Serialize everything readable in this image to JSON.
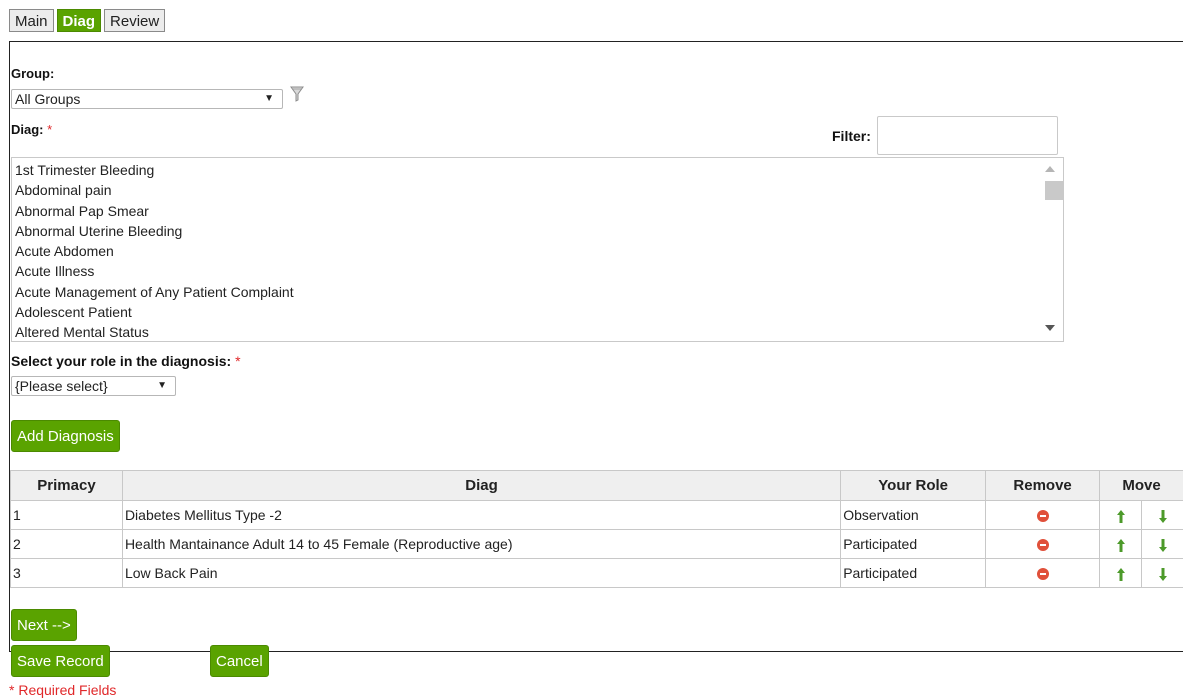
{
  "tabs": [
    {
      "label": "Main",
      "active": false
    },
    {
      "label": "Diag",
      "active": true
    },
    {
      "label": "Review",
      "active": false
    }
  ],
  "group": {
    "label": "Group:",
    "selected": "All Groups",
    "filter_icon": "funnel-icon"
  },
  "diag": {
    "label": "Diag:",
    "required_mark": "*",
    "filter_label": "Filter:",
    "filter_value": "",
    "options": [
      "1st Trimester Bleeding",
      "Abdominal pain",
      "Abnormal Pap Smear",
      "Abnormal Uterine Bleeding",
      "Acute Abdomen",
      "Acute Illness",
      "Acute Management of Any Patient Complaint",
      "Adolescent Patient",
      "Altered Mental Status"
    ]
  },
  "role": {
    "label": "Select your role in the diagnosis:",
    "required_mark": "*",
    "selected": "{Please select}"
  },
  "buttons": {
    "add_diagnosis": "Add Diagnosis",
    "next": "Next -->",
    "save_record": "Save Record",
    "cancel": "Cancel"
  },
  "table": {
    "headers": [
      "Primacy",
      "Diag",
      "Your Role",
      "Remove",
      "Move"
    ],
    "rows": [
      {
        "primacy": "1",
        "diag": "Diabetes Mellitus Type -2",
        "role": "Observation"
      },
      {
        "primacy": "2",
        "diag": "Health Mantainance Adult 14 to 45 Female (Reproductive age)",
        "role": "Participated"
      },
      {
        "primacy": "3",
        "diag": "Low Back Pain",
        "role": "Participated"
      }
    ]
  },
  "footer": {
    "required_note": "* Required Fields"
  },
  "colors": {
    "accent_green": "#5aa300",
    "required_red": "#e0282a",
    "remove_red": "#e0503a",
    "arrow_green": "#4c9a2a"
  }
}
